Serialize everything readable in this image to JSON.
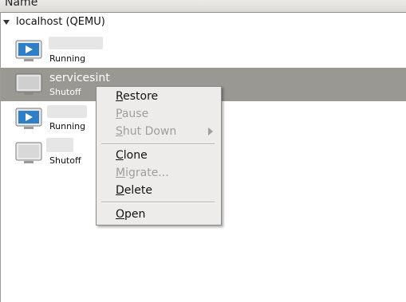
{
  "header": {
    "column_name": "Name"
  },
  "host": {
    "label": "localhost (QEMU)"
  },
  "vms": [
    {
      "name": "",
      "status": "Running",
      "state": "running"
    },
    {
      "name": "servicesint",
      "status": "Shutoff",
      "state": "shutoff"
    },
    {
      "name": "",
      "status": "Running",
      "state": "running"
    },
    {
      "name": "",
      "status": "Shutoff",
      "state": "shutoff"
    }
  ],
  "context_menu": {
    "restore": "Restore",
    "pause": "Pause",
    "shut_down": "Shut Down",
    "clone": "Clone",
    "migrate": "Migrate...",
    "delete": "Delete",
    "open": "Open"
  },
  "colors": {
    "selection": "#9a9893",
    "running_screen": "#2f7fc6",
    "menu_bg": "#edecea",
    "disabled_text": "#9f9e9a"
  }
}
